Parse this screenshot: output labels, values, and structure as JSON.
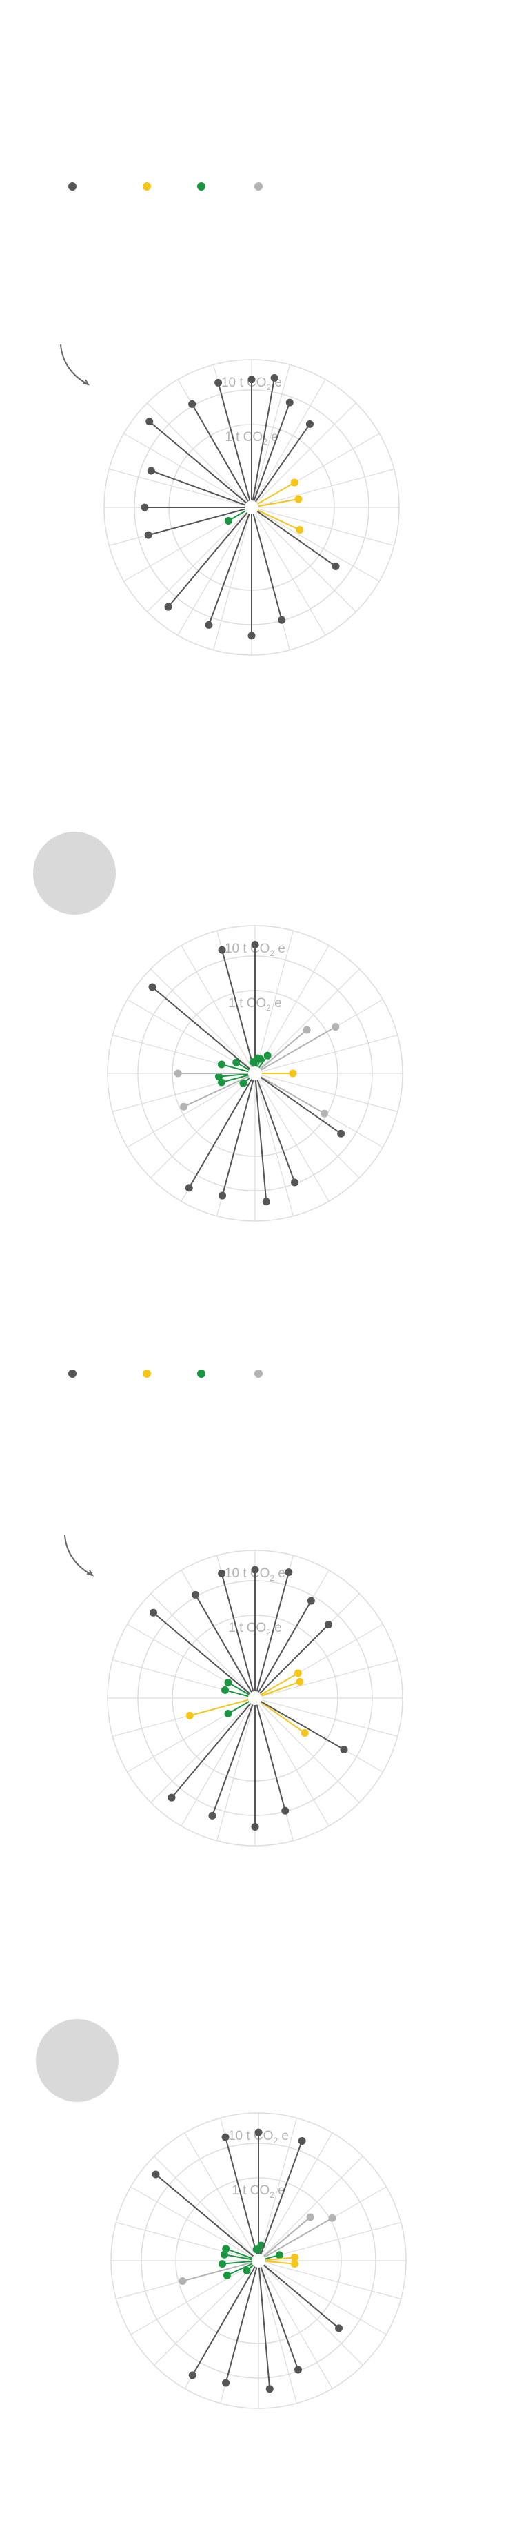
{
  "colors": {
    "emitter": "#555555",
    "neutral": "#f5c518",
    "sink": "#1a9641",
    "other": "#b3b3b3",
    "grid": "#dddddd",
    "label": "#b3b3b3",
    "placeholder": "#d9d9d9"
  },
  "legend": {
    "items": [
      {
        "color_key": "emitter",
        "icon": "dot-dark"
      },
      {
        "color_key": "neutral",
        "icon": "dot-yellow"
      },
      {
        "color_key": "sink",
        "icon": "dot-green"
      },
      {
        "color_key": "other",
        "icon": "dot-gray"
      }
    ]
  },
  "ring_labels": {
    "outer_number": "10",
    "inner_number": "1",
    "unit_t": "t",
    "unit_co": "CO",
    "unit_sub": "2",
    "unit_e": "e"
  },
  "chart_data": [
    {
      "type": "radial-lollipop",
      "spokes": 24,
      "grid": true,
      "rings_tco2e": [
        1,
        10
      ],
      "points": [
        {
          "angle": 0,
          "value": 5.9,
          "cat": "emitter"
        },
        {
          "angle": 10,
          "value": 6.8,
          "cat": "emitter"
        },
        {
          "angle": 20,
          "value": 3.1,
          "cat": "emitter"
        },
        {
          "angle": 35,
          "value": 2.1,
          "cat": "emitter"
        },
        {
          "angle": 60,
          "value": 0.27,
          "cat": "neutral"
        },
        {
          "angle": 80,
          "value": 0.25,
          "cat": "neutral"
        },
        {
          "angle": 115,
          "value": 0.31,
          "cat": "neutral"
        },
        {
          "angle": 125,
          "value": 2.2,
          "cat": "emitter"
        },
        {
          "angle": 165,
          "value": 3.8,
          "cat": "emitter"
        },
        {
          "angle": 180,
          "value": 6.0,
          "cat": "emitter"
        },
        {
          "angle": 200,
          "value": 5.3,
          "cat": "emitter"
        },
        {
          "angle": 220,
          "value": 6.4,
          "cat": "emitter"
        },
        {
          "angle": 240,
          "value": 0.11,
          "cat": "sink"
        },
        {
          "angle": 255,
          "value": 2.6,
          "cat": "emitter"
        },
        {
          "angle": 270,
          "value": 2.6,
          "cat": "emitter"
        },
        {
          "angle": 290,
          "value": 2.6,
          "cat": "emitter"
        },
        {
          "angle": 310,
          "value": 7.4,
          "cat": "emitter"
        },
        {
          "angle": 330,
          "value": 4.2,
          "cat": "emitter"
        },
        {
          "angle": 345,
          "value": 6.2,
          "cat": "emitter"
        }
      ]
    },
    {
      "type": "radial-lollipop",
      "spokes": 24,
      "grid": true,
      "rings_tco2e": [
        1,
        10
      ],
      "points": [
        {
          "angle": 0,
          "value": 6.1,
          "cat": "emitter"
        },
        {
          "angle": 10,
          "value": 0.07,
          "cat": "sink"
        },
        {
          "angle": 20,
          "value": 0.07,
          "cat": "sink"
        },
        {
          "angle": 35,
          "value": 0.09,
          "cat": "sink"
        },
        {
          "angle": 50,
          "value": 0.55,
          "cat": "other"
        },
        {
          "angle": 60,
          "value": 1.5,
          "cat": "other"
        },
        {
          "angle": 90,
          "value": 0.17,
          "cat": "neutral"
        },
        {
          "angle": 120,
          "value": 0.9,
          "cat": "other"
        },
        {
          "angle": 125,
          "value": 2.4,
          "cat": "emitter"
        },
        {
          "angle": 160,
          "value": 3.7,
          "cat": "emitter"
        },
        {
          "angle": 175,
          "value": 6.1,
          "cat": "emitter"
        },
        {
          "angle": 195,
          "value": 5.6,
          "cat": "emitter"
        },
        {
          "angle": 210,
          "value": 7.0,
          "cat": "emitter"
        },
        {
          "angle": 230,
          "value": 0.07,
          "cat": "sink"
        },
        {
          "angle": 245,
          "value": 0.85,
          "cat": "other"
        },
        {
          "angle": 255,
          "value": 0.15,
          "cat": "sink"
        },
        {
          "angle": 265,
          "value": 0.16,
          "cat": "sink"
        },
        {
          "angle": 270,
          "value": 0.8,
          "cat": "other"
        },
        {
          "angle": 285,
          "value": 0.15,
          "cat": "sink"
        },
        {
          "angle": 300,
          "value": 0.09,
          "cat": "sink"
        },
        {
          "angle": 310,
          "value": 7.6,
          "cat": "emitter"
        },
        {
          "angle": 345,
          "value": 5.9,
          "cat": "emitter"
        },
        {
          "angle": 350,
          "value": 0.06,
          "cat": "sink"
        }
      ]
    },
    {
      "type": "radial-lollipop",
      "spokes": 24,
      "grid": true,
      "rings_tco2e": [
        1,
        10
      ],
      "points": [
        {
          "angle": 0,
          "value": 6.0,
          "cat": "emitter"
        },
        {
          "angle": 15,
          "value": 6.5,
          "cat": "emitter"
        },
        {
          "angle": 30,
          "value": 3.2,
          "cat": "emitter"
        },
        {
          "angle": 45,
          "value": 2.3,
          "cat": "emitter"
        },
        {
          "angle": 60,
          "value": 0.27,
          "cat": "neutral"
        },
        {
          "angle": 70,
          "value": 0.25,
          "cat": "neutral"
        },
        {
          "angle": 125,
          "value": 0.42,
          "cat": "neutral"
        },
        {
          "angle": 120,
          "value": 2.2,
          "cat": "emitter"
        },
        {
          "angle": 165,
          "value": 3.8,
          "cat": "emitter"
        },
        {
          "angle": 180,
          "value": 6.1,
          "cat": "emitter"
        },
        {
          "angle": 200,
          "value": 5.3,
          "cat": "emitter"
        },
        {
          "angle": 220,
          "value": 6.4,
          "cat": "emitter"
        },
        {
          "angle": 240,
          "value": 0.13,
          "cat": "sink"
        },
        {
          "angle": 255,
          "value": 0.55,
          "cat": "neutral"
        },
        {
          "angle": 285,
          "value": 0.13,
          "cat": "sink"
        },
        {
          "angle": 300,
          "value": 0.13,
          "cat": "sink"
        },
        {
          "angle": 310,
          "value": 7.2,
          "cat": "emitter"
        },
        {
          "angle": 330,
          "value": 4.2,
          "cat": "emitter"
        },
        {
          "angle": 345,
          "value": 6.2,
          "cat": "emitter"
        }
      ]
    },
    {
      "type": "radial-lollipop",
      "spokes": 24,
      "grid": true,
      "rings_tco2e": [
        1,
        10
      ],
      "points": [
        {
          "angle": 0,
          "value": 6.0,
          "cat": "emitter"
        },
        {
          "angle": 10,
          "value": 0.07,
          "cat": "sink"
        },
        {
          "angle": 20,
          "value": 5.8,
          "cat": "emitter"
        },
        {
          "angle": 50,
          "value": 0.55,
          "cat": "other"
        },
        {
          "angle": 60,
          "value": 1.1,
          "cat": "other"
        },
        {
          "angle": 75,
          "value": 0.09,
          "cat": "sink"
        },
        {
          "angle": 85,
          "value": 0.16,
          "cat": "neutral"
        },
        {
          "angle": 95,
          "value": 0.16,
          "cat": "neutral"
        },
        {
          "angle": 130,
          "value": 2.4,
          "cat": "emitter"
        },
        {
          "angle": 160,
          "value": 3.7,
          "cat": "emitter"
        },
        {
          "angle": 175,
          "value": 6.1,
          "cat": "emitter"
        },
        {
          "angle": 195,
          "value": 5.6,
          "cat": "emitter"
        },
        {
          "angle": 210,
          "value": 7.0,
          "cat": "emitter"
        },
        {
          "angle": 230,
          "value": 0.07,
          "cat": "sink"
        },
        {
          "angle": 245,
          "value": 0.15,
          "cat": "sink"
        },
        {
          "angle": 255,
          "value": 0.85,
          "cat": "other"
        },
        {
          "angle": 265,
          "value": 0.16,
          "cat": "sink"
        },
        {
          "angle": 280,
          "value": 0.15,
          "cat": "sink"
        },
        {
          "angle": 290,
          "value": 0.15,
          "cat": "sink"
        },
        {
          "angle": 310,
          "value": 7.6,
          "cat": "emitter"
        },
        {
          "angle": 345,
          "value": 5.9,
          "cat": "emitter"
        },
        {
          "angle": 350,
          "value": 0.06,
          "cat": "sink"
        }
      ]
    }
  ]
}
